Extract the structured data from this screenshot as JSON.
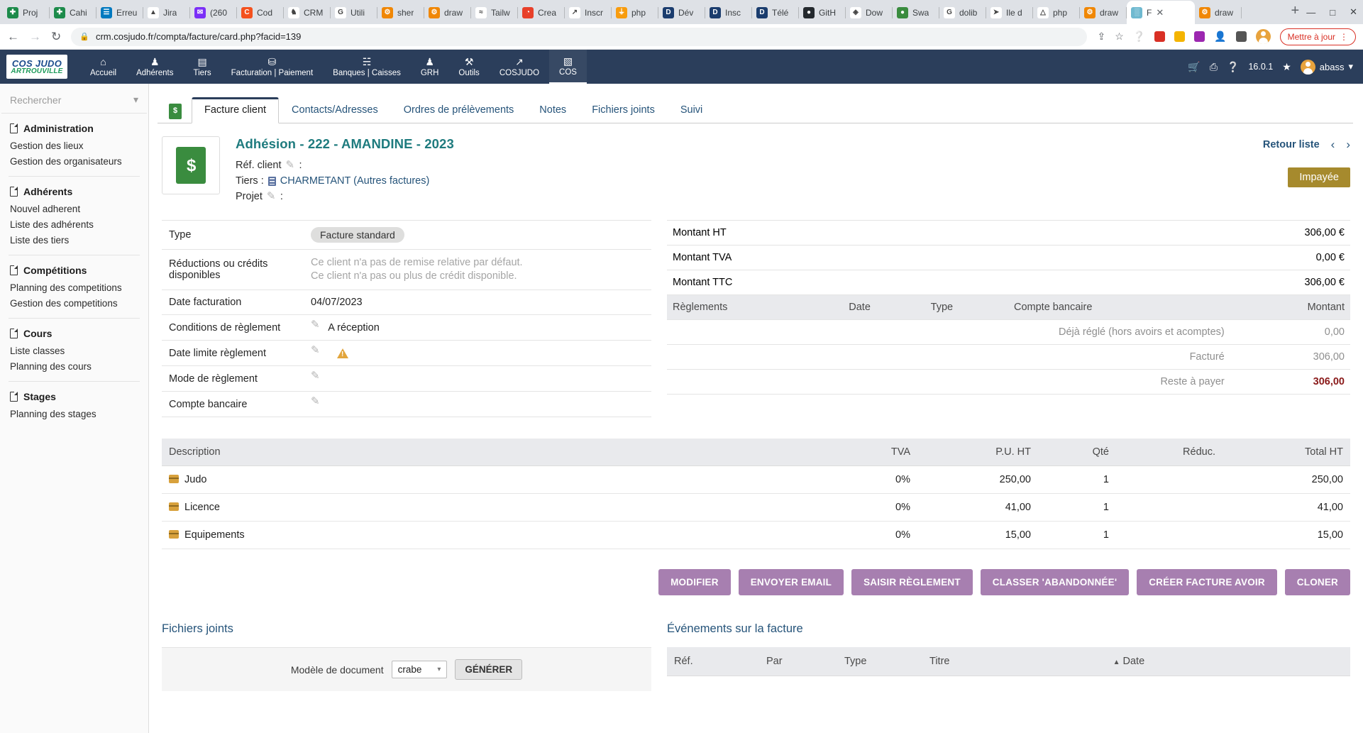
{
  "browser": {
    "tabs": [
      {
        "label": "Proj",
        "icon": "spreadsheet-icon",
        "color": "#1d8b4b",
        "glyph": "✚"
      },
      {
        "label": "Cahi",
        "icon": "spreadsheet-icon",
        "color": "#1d8b4b",
        "glyph": "✚"
      },
      {
        "label": "Erreu",
        "icon": "trello-icon",
        "color": "#0079bf",
        "glyph": "☰"
      },
      {
        "label": "Jira",
        "icon": "jira-icon",
        "color": "#ffffff",
        "glyph": "▲"
      },
      {
        "label": "(260",
        "icon": "mail-icon",
        "color": "#7b2ff7",
        "glyph": "✉"
      },
      {
        "label": "Cod",
        "icon": "code-icon",
        "color": "#f4511e",
        "glyph": "C"
      },
      {
        "label": "CRM",
        "icon": "crm-icon",
        "color": "#ffffff",
        "glyph": "♞"
      },
      {
        "label": "Utili",
        "icon": "google-icon",
        "color": "#ffffff",
        "glyph": "G"
      },
      {
        "label": "sher",
        "icon": "drawio-icon",
        "color": "#f08705",
        "glyph": "⚙"
      },
      {
        "label": "draw",
        "icon": "drawio-icon",
        "color": "#f08705",
        "glyph": "⚙"
      },
      {
        "label": "Tailw",
        "icon": "tailwind-icon",
        "color": "#ffffff",
        "glyph": "≈"
      },
      {
        "label": "Crea",
        "icon": "creative-icon",
        "color": "#e8402a",
        "glyph": "◔"
      },
      {
        "label": "Inscr",
        "icon": "chart-icon",
        "color": "#ffffff",
        "glyph": "↗"
      },
      {
        "label": "php",
        "icon": "phpmyadmin-icon",
        "color": "#f89c0e",
        "glyph": "⏚"
      },
      {
        "label": "Dév",
        "icon": "dolibarr-icon",
        "color": "#1b3d6e",
        "glyph": "D"
      },
      {
        "label": "Insc",
        "icon": "dolibarr-icon",
        "color": "#1b3d6e",
        "glyph": "D"
      },
      {
        "label": "Télé",
        "icon": "dolibarr-icon",
        "color": "#1b3d6e",
        "glyph": "D"
      },
      {
        "label": "GitH",
        "icon": "github-icon",
        "color": "#24292e",
        "glyph": "●"
      },
      {
        "label": "Dow",
        "icon": "diamond-icon",
        "color": "#ffffff",
        "glyph": "◈"
      },
      {
        "label": "Swa",
        "icon": "swagger-icon",
        "color": "#3a8c3f",
        "glyph": "●"
      },
      {
        "label": "dolib",
        "icon": "google-icon",
        "color": "#ffffff",
        "glyph": "G"
      },
      {
        "label": "Ile d",
        "icon": "maps-icon",
        "color": "#ffffff",
        "glyph": "➤"
      },
      {
        "label": "php",
        "icon": "drive-icon",
        "color": "#ffffff",
        "glyph": "△"
      },
      {
        "label": "draw",
        "icon": "drawio-icon",
        "color": "#f08705",
        "glyph": "⚙"
      },
      {
        "label": "F",
        "icon": "favicon-active",
        "color": "#6fb9d0",
        "glyph": "░",
        "active": true
      },
      {
        "label": "draw",
        "icon": "drawio-icon",
        "color": "#f08705",
        "glyph": "⚙"
      }
    ],
    "new_tab_label": "+",
    "close_label": "✕",
    "window_controls": {
      "minimize": "—",
      "maximize": "□",
      "close": "✕"
    },
    "back_icon": "←",
    "forward_icon": "→",
    "reload_icon": "↻",
    "url": "crm.cosjudo.fr/compta/facture/card.php?facid=139",
    "lock_icon": "🔒",
    "update_chip": "Mettre à jour",
    "update_menu_icon": "⋮"
  },
  "topnav": {
    "logo_line1": "COS JUDO",
    "logo_line2": "ARTROUVILLE",
    "items": [
      {
        "label": "Accueil",
        "icon": "home-icon",
        "glyph": "⌂"
      },
      {
        "label": "Adhérents",
        "icon": "user-icon",
        "glyph": "♟"
      },
      {
        "label": "Tiers",
        "icon": "building-icon",
        "glyph": "▤"
      },
      {
        "label": "Facturation | Paiement",
        "icon": "coins-icon",
        "glyph": "⛁"
      },
      {
        "label": "Banques | Caisses",
        "icon": "bank-icon",
        "glyph": "☵"
      },
      {
        "label": "GRH",
        "icon": "employee-icon",
        "glyph": "♟"
      },
      {
        "label": "Outils",
        "icon": "wrench-icon",
        "glyph": "⚒"
      },
      {
        "label": "COSJUDO",
        "icon": "external-link-icon",
        "glyph": "↗"
      },
      {
        "label": "COS",
        "icon": "page-icon",
        "glyph": "▧",
        "active": true
      }
    ],
    "right": {
      "cart_icon": "🛒",
      "print_icon": "⎙",
      "help_icon": "?",
      "version": "16.0.1",
      "star_icon": "★",
      "user": "abass",
      "chevron": "▾"
    }
  },
  "sidebar": {
    "search_placeholder": "Rechercher",
    "search_chevron": "▾",
    "groups": [
      {
        "title": "Administration",
        "items": [
          "Gestion des lieux",
          "Gestion des organisateurs"
        ]
      },
      {
        "title": "Adhérents",
        "items": [
          "Nouvel adherent",
          "Liste des adhérents",
          "Liste des tiers"
        ]
      },
      {
        "title": "Compétitions",
        "items": [
          "Planning des competitions",
          "Gestion des competitions"
        ]
      },
      {
        "title": "Cours",
        "items": [
          "Liste classes",
          "Planning des cours"
        ]
      },
      {
        "title": "Stages",
        "items": [
          "Planning des stages"
        ]
      }
    ]
  },
  "entity_tabs": [
    {
      "label": "Facture client",
      "active": true
    },
    {
      "label": "Contacts/Adresses",
      "active": false
    },
    {
      "label": "Ordres de prélèvements",
      "active": false
    },
    {
      "label": "Notes",
      "active": false
    },
    {
      "label": "Fichiers joints",
      "active": false
    },
    {
      "label": "Suivi",
      "active": false
    }
  ],
  "record": {
    "title": "Adhésion - 222 - AMANDINE - 2023",
    "ref_client_label": "Réf. client",
    "ref_client_value": ":",
    "tiers_label": "Tiers :",
    "tiers_value": "CHARMETANT (Autres factures)",
    "projet_label": "Projet",
    "projet_value": ":",
    "retour_liste": "Retour liste",
    "prev_arrow": "‹",
    "next_arrow": "›",
    "status_badge": "Impayée"
  },
  "details": [
    {
      "key": "Type",
      "value": "Facture standard",
      "kind": "chip"
    },
    {
      "key": "Réductions ou crédits disponibles",
      "value": "Ce client n'a pas de remise relative par défaut.",
      "value2": "Ce client n'a pas ou plus de crédit disponible.",
      "kind": "muted"
    },
    {
      "key": "Date facturation",
      "value": "04/07/2023",
      "kind": "text"
    },
    {
      "key": "Conditions de règlement",
      "value": "A réception",
      "kind": "pencil"
    },
    {
      "key": "Date limite règlement",
      "value": "",
      "kind": "pencil-warn"
    },
    {
      "key": "Mode de règlement",
      "value": "",
      "kind": "pencil"
    },
    {
      "key": "Compte bancaire",
      "value": "",
      "kind": "pencil"
    }
  ],
  "amounts": [
    {
      "label": "Montant HT",
      "value": "306,00 €"
    },
    {
      "label": "Montant TVA",
      "value": "0,00 €"
    },
    {
      "label": "Montant TTC",
      "value": "306,00 €"
    }
  ],
  "payments": {
    "headers": [
      "Règlements",
      "Date",
      "Type",
      "Compte bancaire",
      "Montant"
    ],
    "rows": [
      {
        "label": "Déjà réglé (hors avoirs et acomptes)",
        "amount": "0,00"
      },
      {
        "label": "Facturé",
        "amount": "306,00"
      }
    ],
    "remaining_label": "Reste à payer",
    "remaining_value": "306,00"
  },
  "lines": {
    "headers": [
      "Description",
      "TVA",
      "P.U. HT",
      "Qté",
      "Réduc.",
      "Total HT"
    ],
    "rows": [
      {
        "description": "Judo",
        "tva": "0%",
        "pu": "250,00",
        "qte": "1",
        "reduc": "",
        "total": "250,00"
      },
      {
        "description": "Licence",
        "tva": "0%",
        "pu": "41,00",
        "qte": "1",
        "reduc": "",
        "total": "41,00"
      },
      {
        "description": "Equipements",
        "tva": "0%",
        "pu": "15,00",
        "qte": "1",
        "reduc": "",
        "total": "15,00"
      }
    ]
  },
  "actions": [
    "MODIFIER",
    "ENVOYER EMAIL",
    "SAISIR RÈGLEMENT",
    "CLASSER 'ABANDONNÉE'",
    "CRÉER FACTURE AVOIR",
    "CLONER"
  ],
  "bottom": {
    "files_title": "Fichiers joints",
    "model_label": "Modèle de document",
    "model_value": "crabe",
    "model_chevron": "▾",
    "generate_button": "GÉNÉRER",
    "events_title": "Événements sur la facture",
    "events_headers": [
      "Réf.",
      "Par",
      "Type",
      "Titre",
      "Date"
    ],
    "sort_caret": "▲"
  },
  "colors": {
    "navy": "#2b3e5b",
    "teal": "#1e7b7e",
    "link": "#26547a",
    "violet_button": "#a77fb0",
    "badge_gold": "#a68a2d",
    "danger": "#8a1a1a"
  }
}
